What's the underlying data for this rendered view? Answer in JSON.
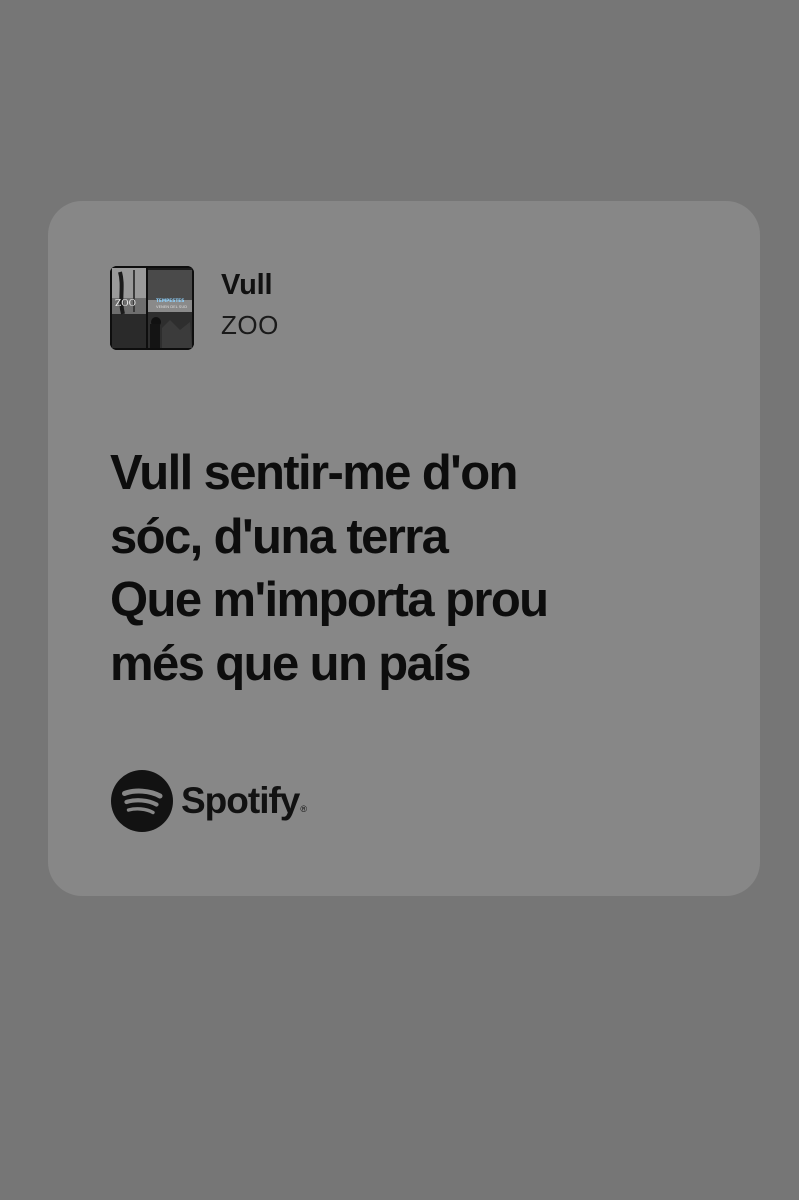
{
  "track": {
    "title": "Vull",
    "artist": "ZOO",
    "cover": {
      "band_text": "ZOO",
      "album_text": "TEMPESTES VENEN DEL SUD"
    }
  },
  "lyrics": [
    "Vull sentir-me d'on",
    "sóc, d'una terra",
    "Que m'importa prou",
    "més que un país"
  ],
  "brand": {
    "name": "Spotify",
    "icon": "spotify-logo-icon"
  },
  "colors": {
    "background": "#767676",
    "card": "#878787",
    "text": "#0d0d0d"
  }
}
